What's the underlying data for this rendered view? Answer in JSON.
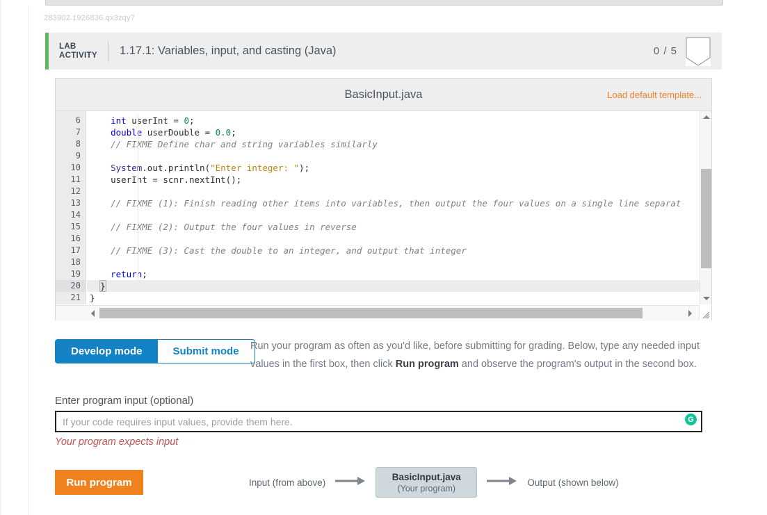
{
  "document_id": "283902.1926836.qx3zqy7",
  "lab_header": {
    "tag_line1": "LAB",
    "tag_line2": "ACTIVITY",
    "title": "1.17.1: Variables, input, and casting (Java)",
    "score": "0 / 5",
    "accent_color": "#5cb85c",
    "background_color": "#eeeeee"
  },
  "code_panel": {
    "filename": "BasicInput.java",
    "load_template_label": "Load default template...",
    "load_template_color": "#f08127",
    "active_line": 20,
    "lines": [
      {
        "n": "6",
        "html": "    <span class='k'>int</span> userInt = <span class='num'>0</span>;"
      },
      {
        "n": "7",
        "html": "    <span class='k'>double</span> userDouble = <span class='num'>0.0</span>;"
      },
      {
        "n": "8",
        "html": "    <span class='cm'>// FIXME Define char and string variables similarly</span>"
      },
      {
        "n": "9",
        "html": ""
      },
      {
        "n": "10",
        "html": "    <span class='cls'>System</span>.out.println(<span class='str'>\"Enter integer: \"</span>);"
      },
      {
        "n": "11",
        "html": "    userInt = scnr.nextInt();"
      },
      {
        "n": "12",
        "html": ""
      },
      {
        "n": "13",
        "html": "    <span class='cm'>// FIXME (1): Finish reading other items into variables, then output the four values on a single line separat</span>"
      },
      {
        "n": "14",
        "html": ""
      },
      {
        "n": "15",
        "html": "    <span class='cm'>// FIXME (2): Output the four values in reverse</span>"
      },
      {
        "n": "16",
        "html": ""
      },
      {
        "n": "17",
        "html": "    <span class='cm'>// FIXME (3): Cast the double to an integer, and output that integer</span>"
      },
      {
        "n": "18",
        "html": ""
      },
      {
        "n": "19",
        "html": "    <span class='k'>return</span>;"
      },
      {
        "n": "20",
        "html": "  <span class='brace-match'>}</span><span class='cursor'></span>"
      },
      {
        "n": "21",
        "html": "}"
      }
    ]
  },
  "modes": {
    "develop_label": "Develop mode",
    "submit_label": "Submit mode",
    "active": "Develop mode",
    "accent_color": "#1383c6",
    "description_part1": "Run your program as often as you'd like, before submitting for grading. Below, type any needed input values in the first box, then click ",
    "description_bold": "Run program",
    "description_part2": " and observe the program's output in the second box."
  },
  "program_input": {
    "label": "Enter program input (optional)",
    "placeholder": "If your code requires input values, provide them here.",
    "value": "",
    "warning": "Your program expects input",
    "warning_color": "#c0504d",
    "assistant_icon": "grammarly-icon",
    "assistant_icon_color": "#15c39a"
  },
  "run_section": {
    "run_label": "Run program",
    "run_color": "#f0821e",
    "flow_input_label": "Input (from above)",
    "flow_program_name": "BasicInput.java",
    "flow_program_sub": "(Your program)",
    "flow_output_label": "Output (shown below)"
  }
}
